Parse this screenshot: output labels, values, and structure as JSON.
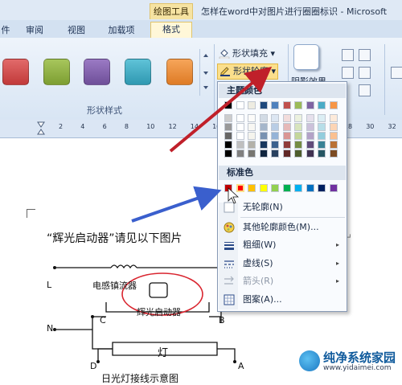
{
  "titlebar": {
    "context_tab": "绘图工具",
    "window_title": "怎样在word中对图片进行圈圈标识 - Microsoft"
  },
  "tabs": [
    {
      "label": "件"
    },
    {
      "label": "审阅"
    },
    {
      "label": "视图"
    },
    {
      "label": "加载项"
    },
    {
      "label": "格式"
    }
  ],
  "ribbon": {
    "shape_styles_group": "形状样式",
    "shape_fill": "形状填充",
    "shape_outline": "形状轮廓",
    "shadow_effect": "阴影效果",
    "fill_dropdown_arrow": "▾",
    "outline_dropdown_arrow": "▾"
  },
  "ruler": {
    "numbers": [
      "2",
      "4",
      "6",
      "8",
      "10",
      "12",
      "14",
      "16",
      "18",
      "20",
      "22",
      "24",
      "26",
      "28",
      "30",
      "32",
      "34"
    ]
  },
  "outline_menu": {
    "theme_colors": "主题颜色",
    "standard_colors": "标准色",
    "no_outline": "无轮廓(N)",
    "more_colors": "其他轮廓颜色(M)...",
    "weight": "粗细(W)",
    "dashes": "虚线(S)",
    "arrows": "箭头(R)",
    "pattern": "图案(A)...",
    "submenu_arrow": "▸",
    "theme_colors_top": [
      "#000000",
      "#ffffff",
      "#eeece1",
      "#1f497d",
      "#4f81bd",
      "#c0504d",
      "#9bbb59",
      "#8064a2",
      "#4bacc6",
      "#f79646"
    ],
    "standard_color_values": [
      "#c00000",
      "#ff0000",
      "#ffc000",
      "#ffff00",
      "#92d050",
      "#00b050",
      "#00b0f0",
      "#0070c0",
      "#002060",
      "#7030a0"
    ]
  },
  "document": {
    "body_text": "“辉光启动器”请见以下图片",
    "para_mark": "↵",
    "diagram": {
      "ballast": "电感镇流器",
      "starter": "辉光启动器",
      "lamp": "灯",
      "caption": "日光灯接线示意图",
      "L": "L",
      "N": "N",
      "A": "A",
      "B": "B",
      "C": "C",
      "D": "D"
    }
  },
  "watermark": {
    "main": "纯净系统家园",
    "sub": "www.yidaimei.com"
  },
  "colors": {
    "highlight": "#fbdf8c",
    "arrow_red": "#c0202a",
    "arrow_blue": "#3a5fcd",
    "annotation_circle": "#d9252f"
  }
}
